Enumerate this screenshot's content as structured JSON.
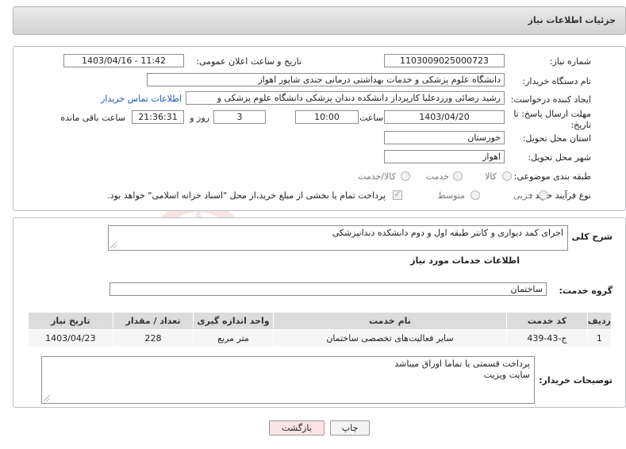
{
  "header": {
    "title": "جزئیات اطلاعات نیاز"
  },
  "form": {
    "need_number_label": "شماره نیاز:",
    "need_number": "1103009025000723",
    "announce_label": "تاریخ و ساعت اعلان عمومی:",
    "announce_value": "1403/04/16 - 11:42",
    "buyer_org_label": "نام دستگاه خریدار:",
    "buyer_org": "دانشگاه علوم پزشکی و خدمات بهداشتی درمانی جندی شاپور اهواز",
    "requester_label": "ایجاد کننده درخواست:",
    "requester": "رشید رضائی ورزدعلیا کارپرداز دانشکده دندان پزشکی دانشگاه علوم پزشکی و",
    "contact_link": "اطلاعات تماس خریدار",
    "deadline_label": "مهلت ارسال پاسخ: تا تاریخ:",
    "deadline_date": "1403/04/20",
    "time_label": "ساعت",
    "deadline_time": "10:00",
    "days_value": "3",
    "days_label": "روز و",
    "remaining_time": "21:36:31",
    "remaining_label": "ساعت باقی مانده",
    "province_label": "استان محل تحویل:",
    "province": "خوزستان",
    "city_label": "شهر محل تحویل:",
    "city": "اهواز",
    "category_label": "طبقه بندی موضوعی:",
    "category_options": [
      "کالا",
      "خدمت",
      "کالا/خدمت"
    ],
    "process_label": "نوع فرآیند خرید :",
    "process_options": [
      "جزیی",
      "متوسط"
    ],
    "payment_note": "پرداخت تمام یا بخشی از مبلغ خرید،از محل \"اسناد خزانه اسلامی\" خواهد بود."
  },
  "summary": {
    "label": "شرح کلی نیاز:",
    "value": "اجرای کمد دیواری و کانتر طبقه اول و دوم دانشکده دندانپزشکی"
  },
  "services": {
    "section_title": "اطلاعات خدمات مورد نیاز",
    "group_label": "گروه خدمت:",
    "group_value": "ساختمان",
    "columns": [
      "ردیف",
      "کد خدمت",
      "نام خدمت",
      "واحد اندازه گیری",
      "تعداد / مقدار",
      "تاریخ نیاز"
    ],
    "rows": [
      [
        "1",
        "ج-43-439",
        "سایر فعالیت‌های تخصصی ساختمان",
        "متر مربع",
        "228",
        "1403/04/23"
      ]
    ]
  },
  "buyer_notes": {
    "label": "توضیحات خریدار:",
    "line1": "پرداخت قسمتی یا تماما اوراق میباشد",
    "line2": "سایت ویزیت"
  },
  "buttons": {
    "print": "چاپ",
    "back": "بازگشت"
  },
  "colors": {
    "link": "#1a58b8",
    "back_button_bg": "#fbe3e3",
    "table_header": "#dcdcdc"
  }
}
